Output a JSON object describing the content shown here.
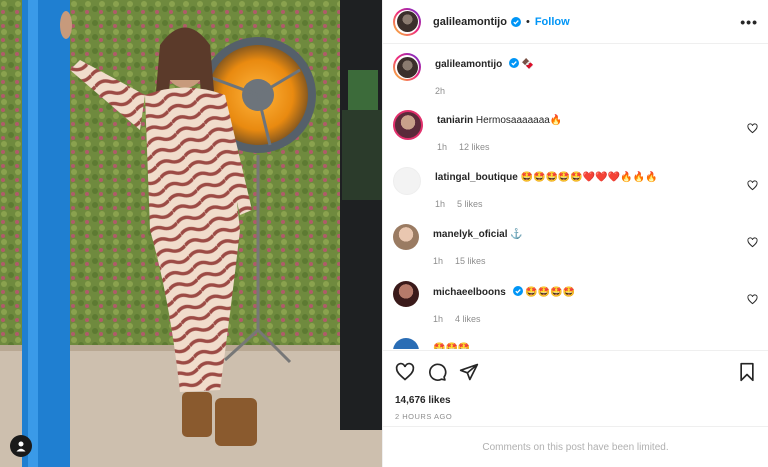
{
  "post": {
    "username": "galileamontijo",
    "dot": "•",
    "follow_label": "Follow",
    "more_label": "•••",
    "caption_emoji": "🍫",
    "caption_time": "2h",
    "likes": "14,676 likes",
    "posted_ago": "2 HOURS AGO",
    "limited_notice": "Comments on this post have been limited."
  },
  "comments": [
    {
      "username": "taniarin",
      "text": "Hermosaaaaaaa🔥",
      "time": "1h",
      "likes": "12 likes"
    },
    {
      "username": "latingal_boutique",
      "text": "🤩🤩🤩🤩🤩❤️❤️❤️🔥🔥🔥",
      "time": "1h",
      "likes": "5 likes"
    },
    {
      "username": "manelyk_oficial",
      "text": "⚓",
      "time": "1h",
      "likes": "15 likes"
    },
    {
      "username": "michaeelboons",
      "text": "🤩🤩🤩🤩",
      "time": "1h",
      "likes": "4 likes"
    },
    {
      "username": "",
      "text": "🤩🤩🤩",
      "time": "",
      "likes": ""
    }
  ],
  "colors": {
    "accent": "#0095f6",
    "muted": "#8e8e8e"
  },
  "icons": [
    "heart-icon",
    "comment-icon",
    "share-icon",
    "bookmark-icon",
    "verified-icon",
    "more-icon",
    "user-tag-icon"
  ]
}
